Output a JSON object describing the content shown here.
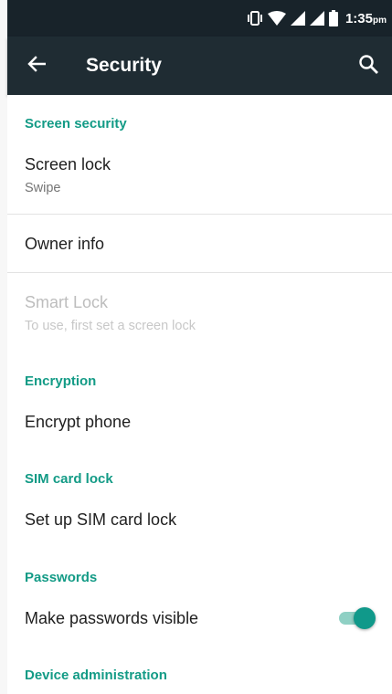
{
  "status_bar": {
    "time": "1:35",
    "ampm": "pm",
    "icons": [
      "vibrate-icon",
      "wifi-icon",
      "signal-icon",
      "signal-icon",
      "battery-icon"
    ]
  },
  "toolbar": {
    "title": "Security",
    "back_icon": "back-arrow-icon",
    "search_icon": "search-icon"
  },
  "sections": {
    "screen_security": "Screen security",
    "encryption": "Encryption",
    "sim_card_lock": "SIM card lock",
    "passwords": "Passwords",
    "device_administration": "Device administration"
  },
  "items": {
    "screen_lock": {
      "title": "Screen lock",
      "summary": "Swipe"
    },
    "owner_info": {
      "title": "Owner info"
    },
    "smart_lock": {
      "title": "Smart Lock",
      "summary": "To use, first set a screen lock",
      "enabled": false
    },
    "encrypt_phone": {
      "title": "Encrypt phone"
    },
    "sim_lock": {
      "title": "Set up SIM card lock"
    },
    "make_passwords_visible": {
      "title": "Make passwords visible",
      "checked": true
    }
  },
  "colors": {
    "accent": "#139b86",
    "toolbar": "#1f2c33",
    "status_bar": "#18232a"
  }
}
